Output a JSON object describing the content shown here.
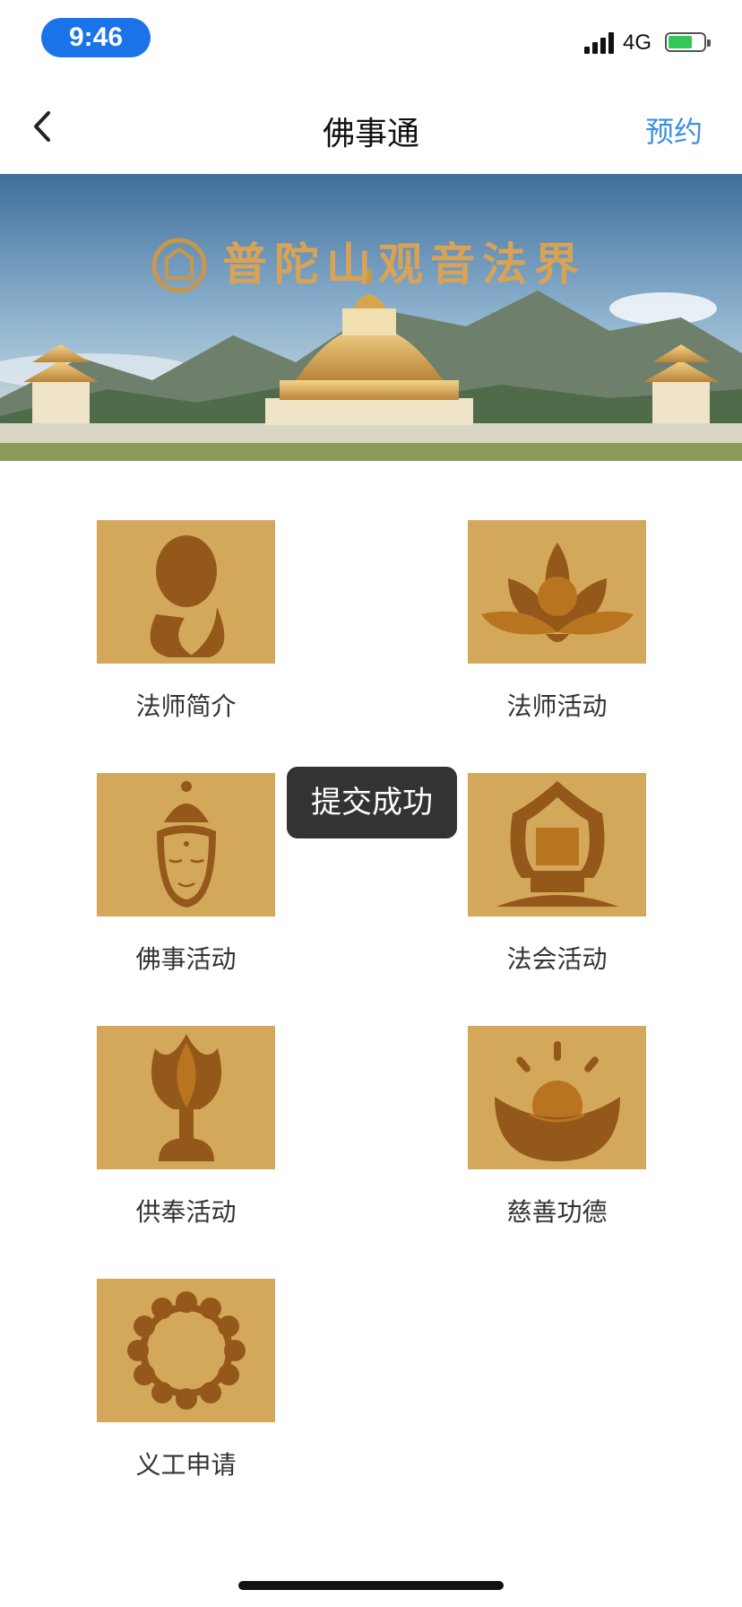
{
  "status_bar": {
    "time": "9:46",
    "network": "4G"
  },
  "nav": {
    "title": "佛事通",
    "action_label": "预约"
  },
  "banner": {
    "text": "普陀山观音法界"
  },
  "menu": {
    "items": [
      {
        "label": "法师简介",
        "icon": "monk-icon"
      },
      {
        "label": "法师活动",
        "icon": "lotus-icon"
      },
      {
        "label": "佛事活动",
        "icon": "buddha-head-icon"
      },
      {
        "label": "法会活动",
        "icon": "shrine-icon"
      },
      {
        "label": "供奉活动",
        "icon": "lotus-lamp-icon"
      },
      {
        "label": "慈善功德",
        "icon": "gold-ingot-icon"
      },
      {
        "label": "义工申请",
        "icon": "prayer-beads-icon"
      }
    ]
  },
  "toast": {
    "message": "提交成功"
  },
  "colors": {
    "tile_bg": "#d4a85a",
    "icon_dark": "#94591a",
    "icon_mid": "#b9741f",
    "accent": "#3d8fe0"
  }
}
